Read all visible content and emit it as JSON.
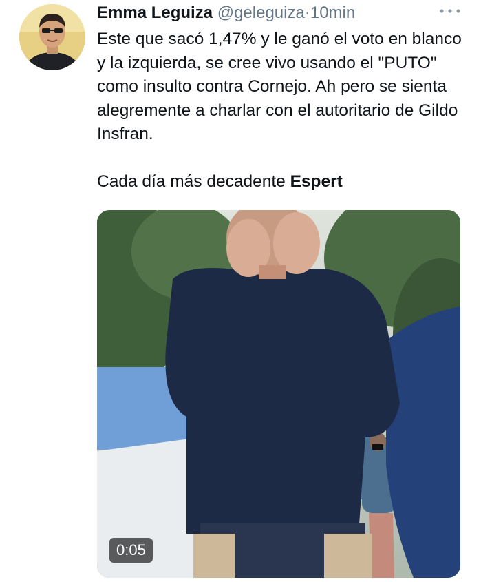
{
  "tweet": {
    "author_name": "Emma Leguiza",
    "author_handle": "@geleguiza",
    "separator": "·",
    "time": "10min",
    "more_icon": "ellipsis-icon",
    "paragraph_1": "Este que sacó 1,47% y le ganó el voto en blanco y la izquierda, se cree vivo usando el \"PUTO\" como insulto contra Cornejo. Ah pero se sienta alegremente a charlar con el autoritario de Gildo Insfran.",
    "paragraph_2_prefix": "Cada día más decadente ",
    "paragraph_2_bold": "Espert",
    "video": {
      "duration": "0:05"
    }
  },
  "colors": {
    "primary_text": "#0f1419",
    "secondary_text": "#657786",
    "duration_badge": "#000000"
  }
}
